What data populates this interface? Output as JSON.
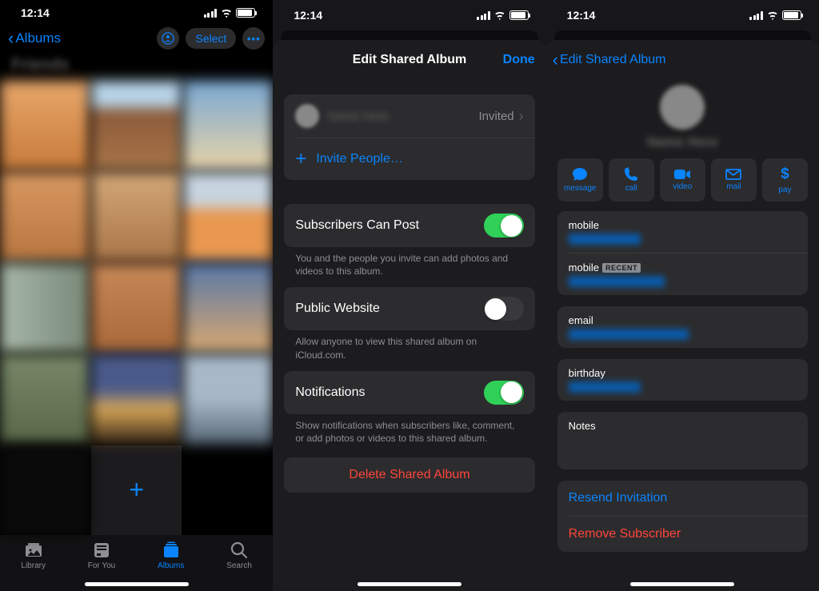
{
  "status": {
    "time": "12:14"
  },
  "screen1": {
    "back_label": "Albums",
    "select_label": "Select",
    "album_name": "Friends",
    "tabs": {
      "library": "Library",
      "foryou": "For You",
      "albums": "Albums",
      "search": "Search"
    }
  },
  "screen2": {
    "title": "Edit Shared Album",
    "done": "Done",
    "invited_status": "Invited",
    "invite_people": "Invite People…",
    "subs_can_post": "Subscribers Can Post",
    "subs_desc": "You and the people you invite can add photos and videos to this album.",
    "public_site": "Public Website",
    "public_desc": "Allow anyone to view this shared album on iCloud.com.",
    "notifications": "Notifications",
    "notif_desc": "Show notifications when subscribers like, comment, or add photos or videos to this shared album.",
    "delete": "Delete Shared Album"
  },
  "screen3": {
    "back_label": "Edit Shared Album",
    "actions": {
      "message": "message",
      "call": "call",
      "video": "video",
      "mail": "mail",
      "pay": "pay"
    },
    "mobile_label": "mobile",
    "recent_badge": "RECENT",
    "email_label": "email",
    "birthday_label": "birthday",
    "notes_label": "Notes",
    "resend": "Resend Invitation",
    "remove": "Remove Subscriber"
  }
}
